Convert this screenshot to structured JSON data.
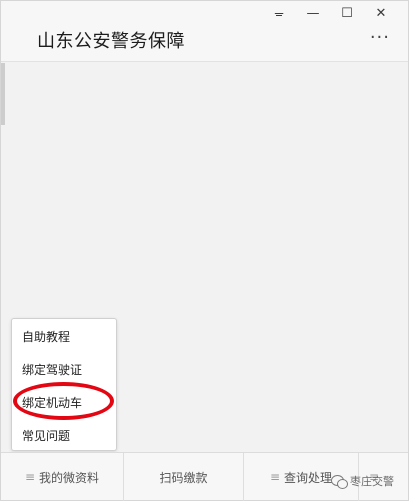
{
  "window": {
    "title": "山东公安警务保障",
    "pin_glyph": "ᚚ",
    "minimize_glyph": "—",
    "maximize_glyph": "☐",
    "close_glyph": "✕",
    "more_glyph": "···"
  },
  "popup_menu": {
    "items": [
      {
        "label": "自助教程"
      },
      {
        "label": "绑定驾驶证"
      },
      {
        "label": "绑定机动车"
      },
      {
        "label": "常见问题"
      }
    ],
    "highlight_color": "#e30613"
  },
  "bottom_menu": {
    "menu_glyph": "≡",
    "tabs": [
      {
        "label": "我的微资料"
      },
      {
        "label": "扫码缴款"
      },
      {
        "label": "查询处理"
      },
      {
        "label": ""
      }
    ]
  },
  "watermark": {
    "text": "枣庄交警"
  }
}
